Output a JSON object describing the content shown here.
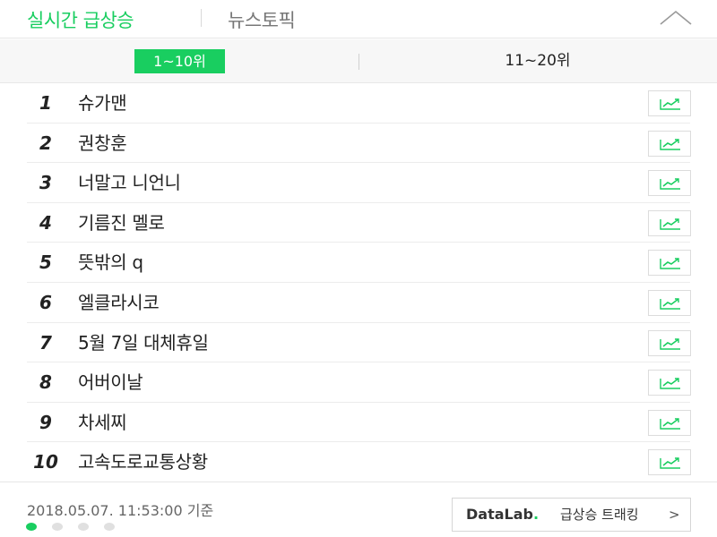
{
  "header": {
    "tab_realtime": "실시간 급상승",
    "tab_news": "뉴스토픽"
  },
  "range_tabs": {
    "active": "1~10위",
    "inactive": "11~20위"
  },
  "ranks": [
    {
      "num": "1",
      "keyword": "슈가맨"
    },
    {
      "num": "2",
      "keyword": "권창훈"
    },
    {
      "num": "3",
      "keyword": "너말고 니언니"
    },
    {
      "num": "4",
      "keyword": "기름진 멜로"
    },
    {
      "num": "5",
      "keyword": "뜻밖의 q"
    },
    {
      "num": "6",
      "keyword": "엘클라시코"
    },
    {
      "num": "7",
      "keyword": "5월 7일 대체휴일"
    },
    {
      "num": "8",
      "keyword": "어버이날"
    },
    {
      "num": "9",
      "keyword": "차세찌"
    },
    {
      "num": "10",
      "keyword": "고속도로교통상황"
    }
  ],
  "footer": {
    "timestamp": "2018.05.07. 11:53:00 기준",
    "datalab_brand_1": "DataLab",
    "datalab_brand_2": ".",
    "datalab_label": "급상승 트래킹",
    "datalab_arrow": ">",
    "page_dots_total": 4,
    "page_dots_active": 1
  },
  "colors": {
    "accent": "#19ce60",
    "text": "#222222",
    "muted": "#777777"
  },
  "icons": [
    "chevron-up-icon",
    "trend-chart-icon",
    "chevron-right-icon"
  ]
}
